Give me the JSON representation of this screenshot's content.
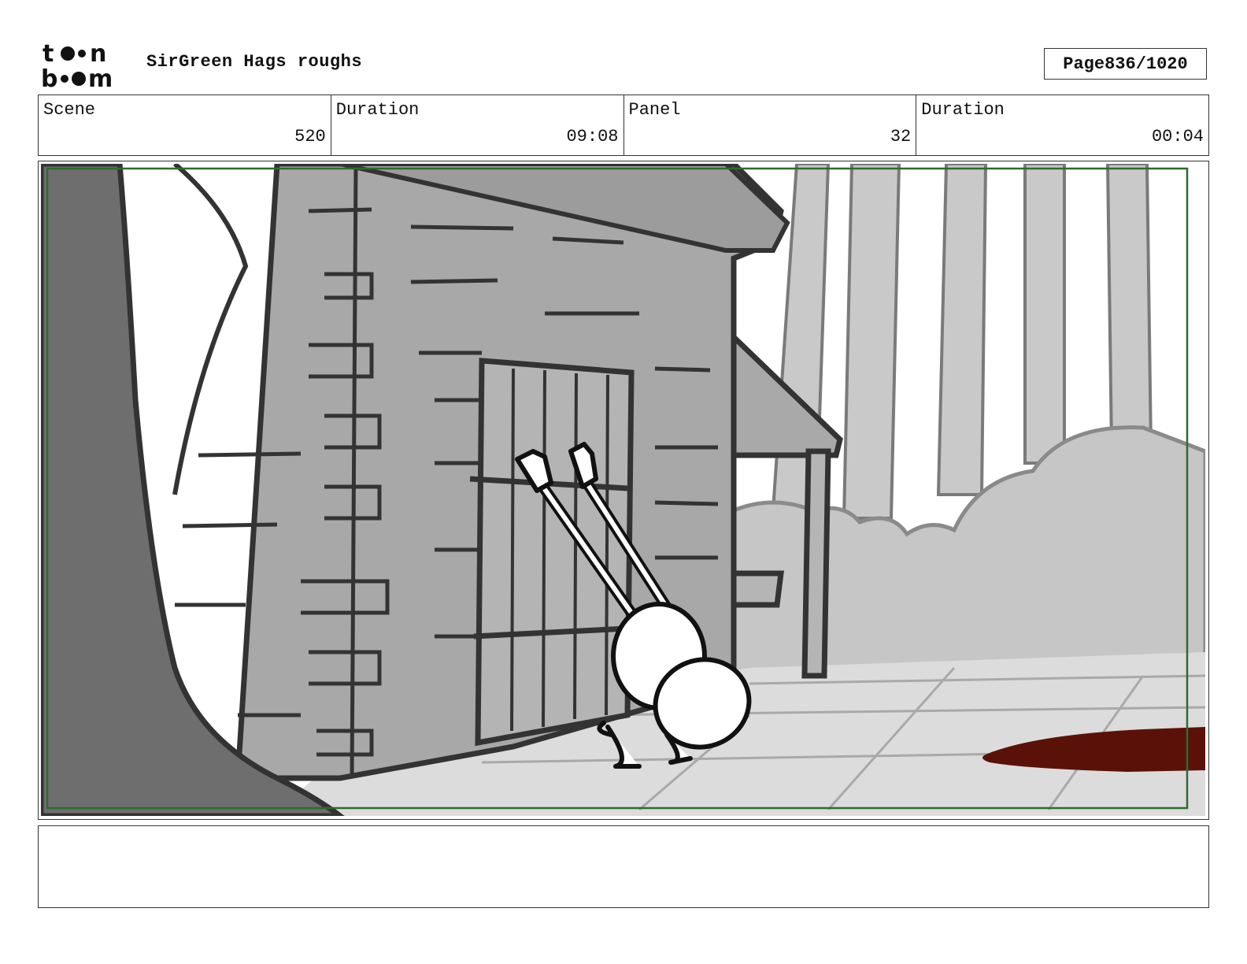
{
  "header": {
    "logo_text": "toonboom",
    "title": "SirGreen Hags roughs",
    "page_label": "Page",
    "page_value": "836/1020"
  },
  "info": {
    "scene_label": "Scene",
    "scene_value": "520",
    "duration_label": "Duration",
    "duration_value": "09:08",
    "panel_label": "Panel",
    "panel_value": "32",
    "panel_duration_label": "Duration",
    "panel_duration_value": "00:04"
  },
  "panel": {
    "safe_frame_color": "#2e6b2e",
    "blood_color": "#5a1208"
  },
  "notes": {
    "text": ""
  }
}
